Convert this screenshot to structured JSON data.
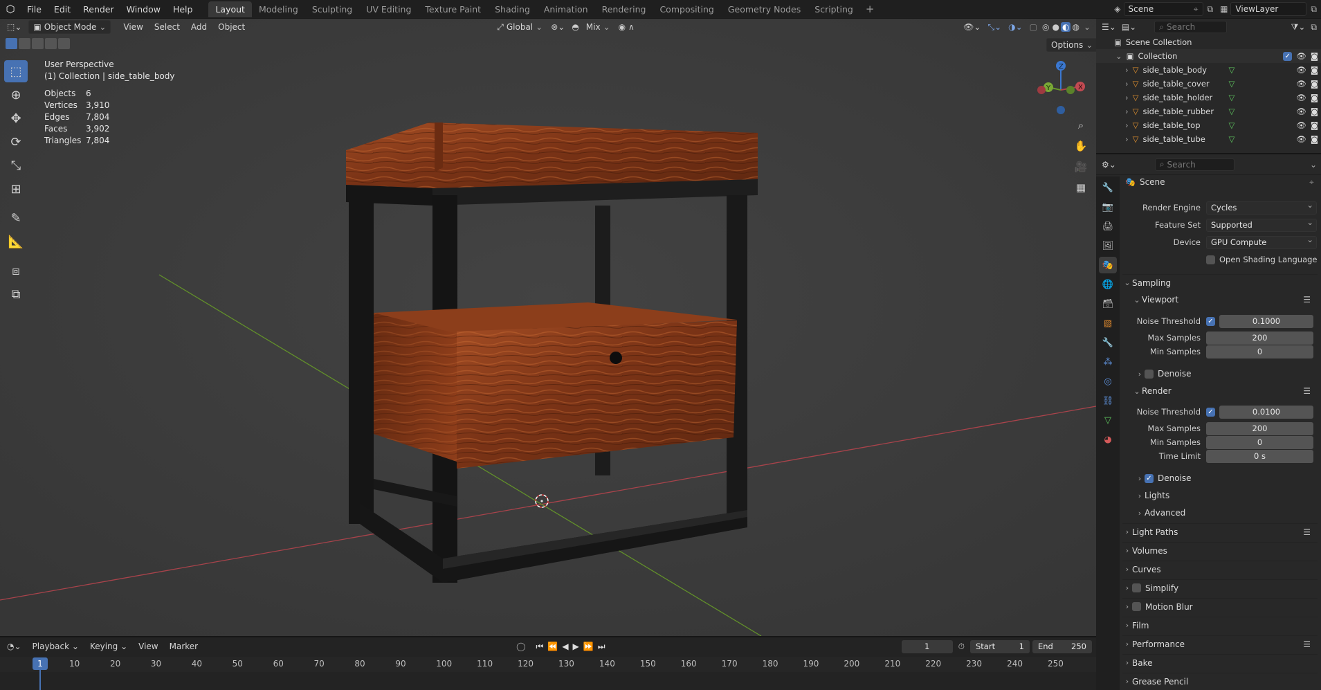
{
  "topbar": {
    "menus": [
      "File",
      "Edit",
      "Render",
      "Window",
      "Help"
    ],
    "workspaces": [
      "Layout",
      "Modeling",
      "Sculpting",
      "UV Editing",
      "Texture Paint",
      "Shading",
      "Animation",
      "Rendering",
      "Compositing",
      "Geometry Nodes",
      "Scripting"
    ],
    "active_workspace": "Layout",
    "scene": "Scene",
    "view_layer": "ViewLayer"
  },
  "viewport_header": {
    "mode": "Object Mode",
    "menus": [
      "View",
      "Select",
      "Add",
      "Object"
    ],
    "orientation": "Global",
    "snap": "Mix",
    "options": "Options"
  },
  "overlay": {
    "perspective": "User Perspective",
    "collection": "(1) Collection | side_table_body",
    "stats": [
      {
        "label": "Objects",
        "value": "6"
      },
      {
        "label": "Vertices",
        "value": "3,910"
      },
      {
        "label": "Edges",
        "value": "7,804"
      },
      {
        "label": "Faces",
        "value": "3,902"
      },
      {
        "label": "Triangles",
        "value": "7,804"
      }
    ]
  },
  "outliner": {
    "search_placeholder": "Search",
    "scene_collection": "Scene Collection",
    "collection": "Collection",
    "objects": [
      "side_table_body",
      "side_table_cover",
      "side_table_holder",
      "side_table_rubber",
      "side_table_top",
      "side_table_tube"
    ]
  },
  "properties": {
    "search_placeholder": "Search",
    "context": "Scene",
    "render_engine_label": "Render Engine",
    "render_engine": "Cycles",
    "feature_set_label": "Feature Set",
    "feature_set": "Supported",
    "device_label": "Device",
    "device": "GPU Compute",
    "osl_label": "Open Shading Language",
    "sampling": "Sampling",
    "viewport": "Viewport",
    "render": "Render",
    "noise_threshold_label": "Noise Threshold",
    "max_samples_label": "Max Samples",
    "min_samples_label": "Min Samples",
    "time_limit_label": "Time Limit",
    "vp_noise_threshold": "0.1000",
    "vp_max_samples": "200",
    "vp_min_samples": "0",
    "r_noise_threshold": "0.0100",
    "r_max_samples": "200",
    "r_min_samples": "0",
    "r_time_limit": "0 s",
    "denoise": "Denoise",
    "lights": "Lights",
    "advanced": "Advanced",
    "panels": [
      "Light Paths",
      "Volumes",
      "Curves",
      "Simplify",
      "Motion Blur",
      "Film",
      "Performance",
      "Bake",
      "Grease Pencil"
    ]
  },
  "timeline": {
    "menus": [
      "Playback",
      "Keying",
      "View",
      "Marker"
    ],
    "current_frame": "1",
    "start_label": "Start",
    "start": "1",
    "end_label": "End",
    "end": "250",
    "ticks": [
      "1",
      "10",
      "20",
      "30",
      "40",
      "50",
      "60",
      "70",
      "80",
      "90",
      "100",
      "110",
      "120",
      "130",
      "140",
      "150",
      "160",
      "170",
      "180",
      "190",
      "200",
      "210",
      "220",
      "230",
      "240",
      "250"
    ]
  },
  "colors": {
    "accent": "#4772b3",
    "wood": "#8a3f1c",
    "metal": "#1a1a1a",
    "x_axis": "#b3414a",
    "y_axis": "#6a9a2a",
    "z_axis": "#3b78d1"
  }
}
